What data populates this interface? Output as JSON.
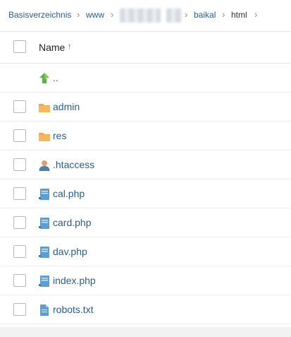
{
  "breadcrumb": {
    "root": "Basisverzeichnis",
    "items": [
      "www",
      "baikal",
      "html"
    ]
  },
  "table": {
    "header": {
      "name_label": "Name",
      "sort_icon": "arrow-up-icon"
    },
    "parent_label": "..",
    "rows": [
      {
        "name": "admin",
        "icon": "folder-icon"
      },
      {
        "name": "res",
        "icon": "folder-icon"
      },
      {
        "name": ".htaccess",
        "icon": "user-file-icon"
      },
      {
        "name": "cal.php",
        "icon": "code-file-icon"
      },
      {
        "name": "card.php",
        "icon": "code-file-icon"
      },
      {
        "name": "dav.php",
        "icon": "code-file-icon"
      },
      {
        "name": "index.php",
        "icon": "code-file-icon"
      },
      {
        "name": "robots.txt",
        "icon": "text-file-icon"
      }
    ]
  },
  "colors": {
    "link": "#2a5d8a",
    "folder": "#f0a84a",
    "accent": "#1d6fb5",
    "up_arrow": "#59b33c"
  }
}
